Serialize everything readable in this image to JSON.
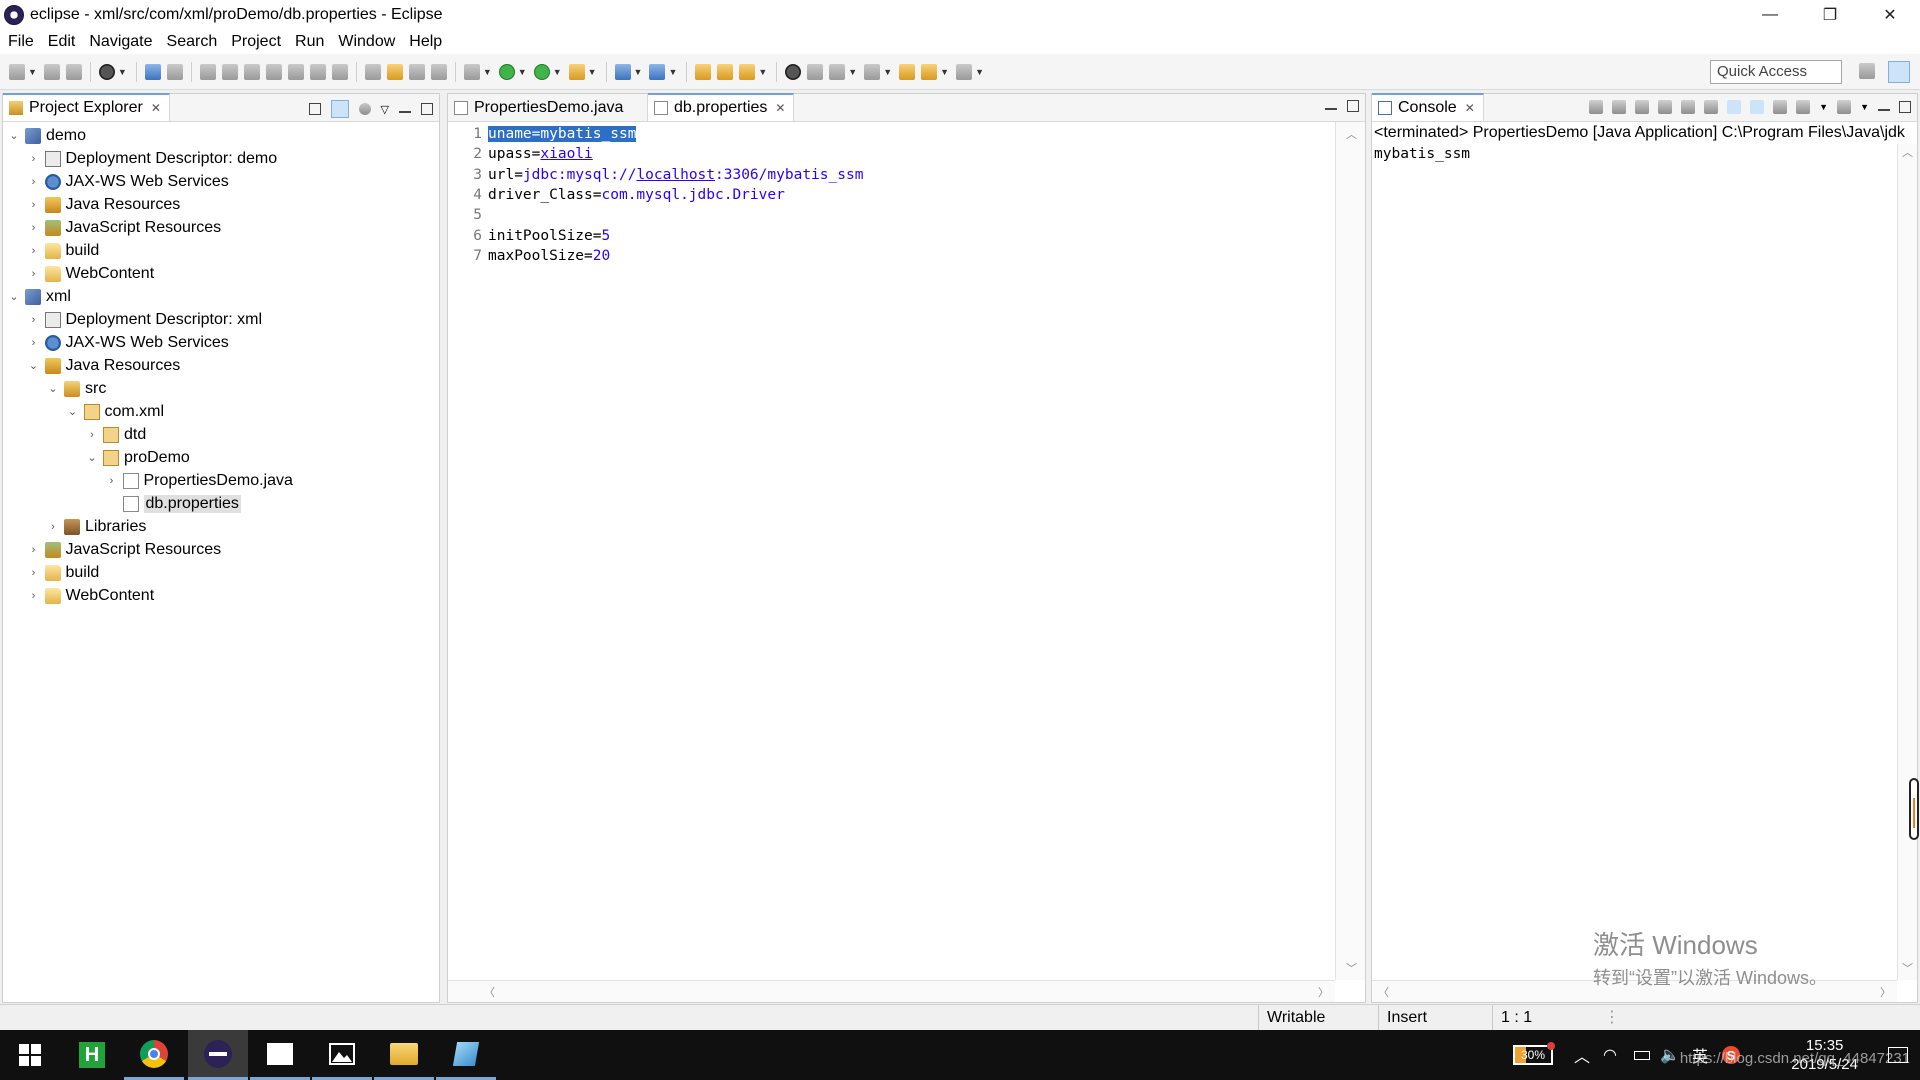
{
  "window": {
    "title": "eclipse - xml/src/com/xml/proDemo/db.properties - Eclipse",
    "minimize": "—",
    "restore": "❐",
    "close": "✕"
  },
  "menu": [
    "File",
    "Edit",
    "Navigate",
    "Search",
    "Project",
    "Run",
    "Window",
    "Help"
  ],
  "toolbar": {
    "quick_access": "Quick Access"
  },
  "explorer": {
    "title": "Project Explorer",
    "tree": [
      {
        "label": "demo",
        "depth": 0,
        "twisty": "open",
        "icon": "project-icon"
      },
      {
        "label": "Deployment Descriptor: demo",
        "depth": 1,
        "twisty": "closed",
        "icon": "deployment-descriptor-icon"
      },
      {
        "label": "JAX-WS Web Services",
        "depth": 1,
        "twisty": "closed",
        "icon": "web-services-icon"
      },
      {
        "label": "Java Resources",
        "depth": 1,
        "twisty": "closed",
        "icon": "java-resources-icon"
      },
      {
        "label": "JavaScript Resources",
        "depth": 1,
        "twisty": "closed",
        "icon": "javascript-resources-icon"
      },
      {
        "label": "build",
        "depth": 1,
        "twisty": "closed",
        "icon": "folder-icon"
      },
      {
        "label": "WebContent",
        "depth": 1,
        "twisty": "closed",
        "icon": "folder-icon"
      },
      {
        "label": "xml",
        "depth": 0,
        "twisty": "open",
        "icon": "project-icon"
      },
      {
        "label": "Deployment Descriptor: xml",
        "depth": 1,
        "twisty": "closed",
        "icon": "deployment-descriptor-icon"
      },
      {
        "label": "JAX-WS Web Services",
        "depth": 1,
        "twisty": "closed",
        "icon": "web-services-icon"
      },
      {
        "label": "Java Resources",
        "depth": 1,
        "twisty": "open",
        "icon": "java-resources-icon"
      },
      {
        "label": "src",
        "depth": 2,
        "twisty": "open",
        "icon": "source-folder-icon"
      },
      {
        "label": "com.xml",
        "depth": 3,
        "twisty": "open",
        "icon": "package-icon"
      },
      {
        "label": "dtd",
        "depth": 4,
        "twisty": "closed",
        "icon": "package-icon"
      },
      {
        "label": "proDemo",
        "depth": 4,
        "twisty": "open",
        "icon": "package-icon"
      },
      {
        "label": "PropertiesDemo.java",
        "depth": 5,
        "twisty": "closed",
        "icon": "java-file-icon"
      },
      {
        "label": "db.properties",
        "depth": 5,
        "twisty": "none",
        "icon": "properties-file-icon",
        "selected": true
      },
      {
        "label": "Libraries",
        "depth": 2,
        "twisty": "closed",
        "icon": "libraries-icon"
      },
      {
        "label": "JavaScript Resources",
        "depth": 1,
        "twisty": "closed",
        "icon": "javascript-resources-icon"
      },
      {
        "label": "build",
        "depth": 1,
        "twisty": "closed",
        "icon": "folder-icon"
      },
      {
        "label": "WebContent",
        "depth": 1,
        "twisty": "closed",
        "icon": "folder-icon"
      }
    ]
  },
  "editor": {
    "tabs": [
      {
        "label": "PropertiesDemo.java",
        "active": false
      },
      {
        "label": "db.properties",
        "active": true
      }
    ],
    "lines": [
      {
        "n": "1",
        "key": "uname",
        "eq": "=",
        "val": "mybatis_ssm",
        "selected": true
      },
      {
        "n": "2",
        "key": "upass",
        "eq": "=",
        "val": "xiaoli",
        "underline": true
      },
      {
        "n": "3",
        "key": "url",
        "eq": "=",
        "val": "jdbc:mysql://localhost:3306/mybatis_ssm",
        "underline_part": "localhost"
      },
      {
        "n": "4",
        "key": "driver_Class",
        "eq": "=",
        "val": "com.mysql.jdbc.Driver"
      },
      {
        "n": "5",
        "key": "",
        "eq": "",
        "val": ""
      },
      {
        "n": "6",
        "key": "initPoolSize",
        "eq": "=",
        "val": "5"
      },
      {
        "n": "7",
        "key": "maxPoolSize",
        "eq": "=",
        "val": "20"
      }
    ]
  },
  "console": {
    "title": "Console",
    "terminated": "<terminated> PropertiesDemo [Java Application] C:\\Program Files\\Java\\jdk",
    "output": "mybatis_ssm"
  },
  "status": {
    "writable": "Writable",
    "insert": "Insert",
    "position": "1 : 1"
  },
  "watermark": {
    "line1": "激活 Windows",
    "line2": "转到“设置”以激活 Windows。"
  },
  "taskbar": {
    "battery": "30%",
    "ime": "英",
    "time": "15:35",
    "date": "2019/5/24",
    "url": "https://blog.csdn.net/qq_44847231"
  },
  "colors": {
    "accent": "#2d6fc4",
    "value_text": "#2a00ff",
    "active_tab_border": "#6ea2d6"
  }
}
